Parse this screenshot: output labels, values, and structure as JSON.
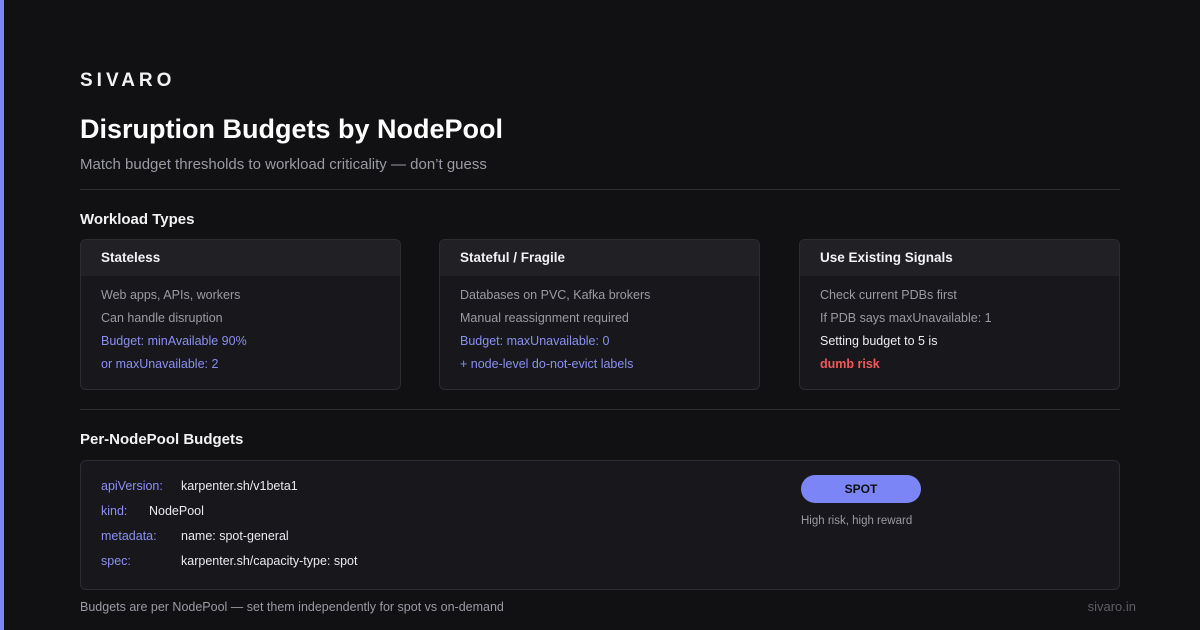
{
  "brand": "SIVARO",
  "title": "Disruption Budgets by NodePool",
  "subtitle": "Match budget thresholds to workload criticality — don’t guess",
  "workload_section": {
    "title": "Workload Types",
    "cards": [
      {
        "heading": "Stateless",
        "lines": [
          "Web apps, APIs, workers",
          "Can handle disruption",
          "Budget: minAvailable 90%",
          "or maxUnavailable: 2"
        ]
      },
      {
        "heading": "Stateful / Fragile",
        "lines": [
          "Databases on PVC, Kafka brokers",
          "Manual reassignment required",
          "Budget: maxUnavailable: 0",
          "+ node-level do-not-evict labels"
        ]
      },
      {
        "heading": "Use Existing Signals",
        "lines": [
          "Check current PDBs first",
          "If PDB says maxUnavailable: 1",
          "Setting budget to 5 is",
          "dumb risk"
        ]
      }
    ]
  },
  "nodepool_section": {
    "title": "Per-NodePool Budgets",
    "yaml": [
      {
        "key": "apiVersion:",
        "value": "karpenter.sh/v1beta1"
      },
      {
        "key": "kind:",
        "value": "NodePool"
      },
      {
        "key": "metadata:",
        "value": "name: spot-general"
      },
      {
        "key": "spec:",
        "value": "karpenter.sh/capacity-type: spot"
      }
    ],
    "spot_label": "SPOT",
    "spot_caption": "High risk, high reward"
  },
  "footer": {
    "note": "Budgets are per NodePool — set them independently for spot vs on-demand",
    "domain": "sivaro.in"
  },
  "colors": {
    "background": "#111114",
    "accent": "#7c85f5",
    "danger": "#f25a5a"
  }
}
